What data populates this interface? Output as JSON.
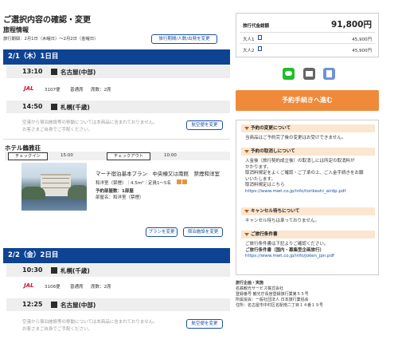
{
  "header": {
    "title": "ご選択内容の確認・変更",
    "subtitle": "旅程情報",
    "dates": "旅行期間：2月1日（木曜日）～2月2日（金曜日）",
    "change_button": "旅行期間/人数/出発を変更"
  },
  "days": [
    {
      "header": "2/1（木）1日目",
      "dep": {
        "time": "13:10",
        "city": "名古屋(中部)"
      },
      "flight": {
        "airline": "JAL",
        "number": "3107便",
        "class": "普通席",
        "seat": "席数：2席"
      },
      "arr": {
        "time": "14:50",
        "city": "札幌(千歳)"
      },
      "note1": "空港から宿泊施設等の移動については本商品に含まれておりません。",
      "note2": "お客さまご自身でご手配ください。",
      "flight_button": "航空便を変更"
    },
    {
      "header": "2/2（金）2日目",
      "dep": {
        "time": "10:30",
        "city": "札幌(千歳)"
      },
      "flight": {
        "airline": "JAL",
        "number": "3106便",
        "class": "普通席",
        "seat": "席数：2席"
      },
      "arr": {
        "time": "12:25",
        "city": "名古屋(中部)"
      },
      "note1": "空港から宿泊施設等の移動については本商品に含まれておりません。",
      "note2": "お客さまご自身でご手配ください。",
      "flight_button": "航空便を変更"
    }
  ],
  "hotel": {
    "name": "ホテル鶴雅荘",
    "checkin_label": "チェックイン",
    "checkin": "15:00",
    "checkout_label": "チェックアウト",
    "checkout": "10:00",
    "plan": "マーチ宿泊基本プラン　中央棟又は南館　禁煙和洋室",
    "room": "和洋室（禁煙）｜4.5ｍ²｜定員1〜5名",
    "rooms_label": "予約部屋数：1部屋",
    "room_name": "部屋名：和洋室（禁煙）",
    "plan_button": "プランを変更",
    "hotel_button": "宿泊施設を変更"
  },
  "sidebar": {
    "total_label": "旅行代金総額",
    "total": "91,800円",
    "rows": [
      {
        "label": "大人1",
        "price": "45,900円"
      },
      {
        "label": "大人2",
        "price": "45,900円"
      }
    ],
    "proceed": "予約手続きへ進む",
    "sections": [
      {
        "title": "予約の変更について",
        "lines": [
          "当商品はご予約完了後の変更はお受けできません。"
        ]
      },
      {
        "title": "予約の取消しについて",
        "lines": [
          "入金後（旅行契約成立後）の取消しには所定の取消料が",
          "かかります。",
          "取消料規定をよくご確認・ご了承の上、ご入金手続きをお願",
          "いいたします。",
          "取消料規定はこちら"
        ],
        "link": "https://www.mwt.co.jp/info/torikeshi_airdp.pdf"
      },
      {
        "title": "キャンセル待ちについて",
        "lines": [
          "キャンセル待ちは承っておりません。"
        ]
      },
      {
        "title": "ご旅行条件書",
        "lines": [
          "ご旅行条件書は下記よりご確認ください。",
          "ご旅行条件書（国内・募集型企画旅行）"
        ],
        "link": "https://www.mwt.co.jp/info/joken_jpn.pdf"
      }
    ],
    "company": [
      "旅行企画・実施",
      "名鉄観光サービス株式会社",
      "登録番号 観光庁長官登録旅行業第５５号",
      "所属協会：一般社団法人 日本旅行業協会",
      "住所：名古屋市中村区名駅南二丁目１４番１９号"
    ]
  },
  "colors": {
    "navy": "#0e4394",
    "orange": "#ef8a3b",
    "line": "#1dbf2b",
    "beige": "#fbe6cf"
  }
}
